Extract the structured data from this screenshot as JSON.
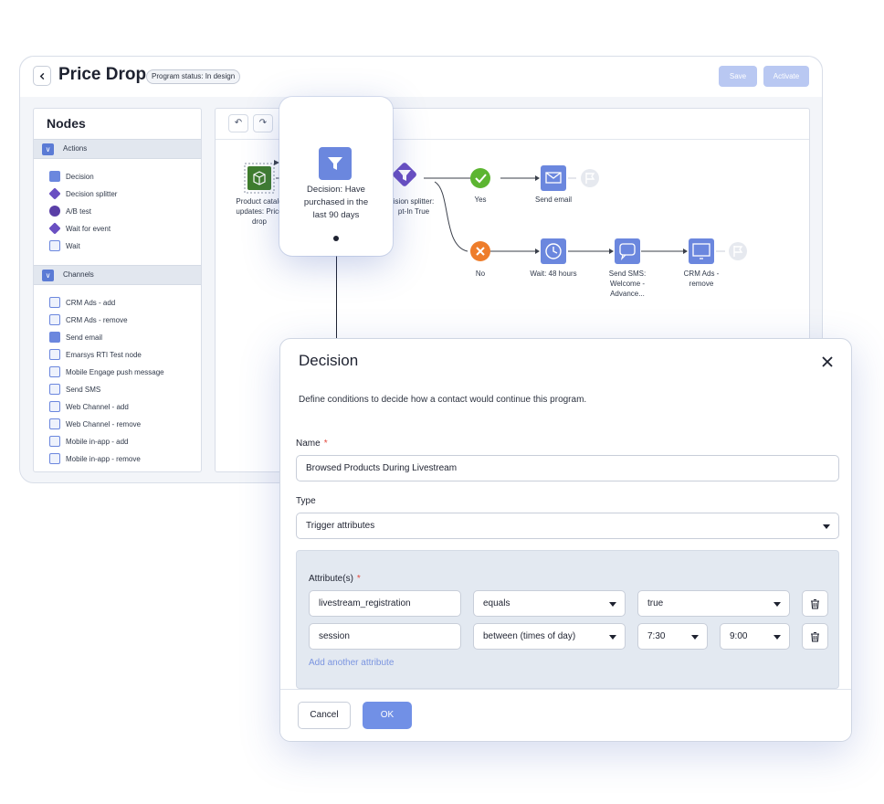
{
  "header": {
    "title": "Price Drop",
    "status_badge": "Program status: In design",
    "save_label": "Save",
    "activate_label": "Activate"
  },
  "nodes_panel": {
    "title": "Nodes",
    "sections": [
      {
        "label": "Actions",
        "items": [
          {
            "label": "Decision",
            "icon": "decision-icon"
          },
          {
            "label": "Decision splitter",
            "icon": "decision-splitter-icon"
          },
          {
            "label": "A/B test",
            "icon": "ab-test-icon"
          },
          {
            "label": "Wait for event",
            "icon": "wait-for-event-icon"
          },
          {
            "label": "Wait",
            "icon": "wait-icon"
          }
        ]
      },
      {
        "label": "Channels",
        "items": [
          {
            "label": "CRM Ads - add",
            "icon": "crm-ads-icon"
          },
          {
            "label": "CRM Ads - remove",
            "icon": "crm-ads-icon"
          },
          {
            "label": "Send email",
            "icon": "email-icon"
          },
          {
            "label": "Emarsys RTI Test node",
            "icon": "rti-icon"
          },
          {
            "label": "Mobile Engage push message",
            "icon": "push-icon"
          },
          {
            "label": "Send SMS",
            "icon": "sms-icon"
          },
          {
            "label": "Web Channel - add",
            "icon": "web-channel-icon"
          },
          {
            "label": "Web Channel - remove",
            "icon": "web-channel-icon"
          },
          {
            "label": "Mobile in-app - add",
            "icon": "mobile-icon"
          },
          {
            "label": "Mobile in-app - remove",
            "icon": "mobile-icon"
          }
        ]
      }
    ]
  },
  "canvas": {
    "undo_icon": "undo-icon",
    "redo_icon": "redo-icon",
    "flow_nodes": {
      "product_catalog_l1": "Product catalo",
      "product_catalog_l2": "updates: Price",
      "product_catalog_l3": "drop",
      "splitter_l1": "ision splitter:",
      "splitter_l2": "pt-In True",
      "yes": "Yes",
      "send_email": "Send email",
      "no": "No",
      "wait_48": "Wait: 48 hours",
      "sms_l1": "Send SMS:",
      "sms_l2": "Welcome -",
      "sms_l3": "Advance...",
      "crm_l1": "CRM Ads -",
      "crm_l2": "remove"
    },
    "highlight_node": {
      "label_l1": "Decision: Have",
      "label_l2": "purchased in the",
      "label_l3": "last 90 days"
    }
  },
  "dialog": {
    "title": "Decision",
    "description": "Define conditions to decide how a contact would continue this program.",
    "name_label": "Name",
    "name_value": "Browsed Products During Livestream",
    "type_label": "Type",
    "type_value": "Trigger attributes",
    "attributes_label": "Attribute(s)",
    "required_marker": "*",
    "attributes": [
      {
        "attribute": "livestream_registration",
        "operator": "equals",
        "value": "true"
      },
      {
        "attribute": "session",
        "operator": "between (times of day)",
        "from": "7:30",
        "to": "9:00"
      }
    ],
    "add_attribute_label": "Add another attribute",
    "cancel_label": "Cancel",
    "ok_label": "OK"
  },
  "colors": {
    "accent": "#6b87de",
    "primary_button": "#7190e6",
    "disabled_button": "#b9c8f2",
    "yes_green": "#5cb531",
    "no_orange": "#ee7d2b",
    "splitter_purple": "#6a4fc2",
    "entry_green": "#3f7d2c",
    "required_red": "#e2483d"
  }
}
